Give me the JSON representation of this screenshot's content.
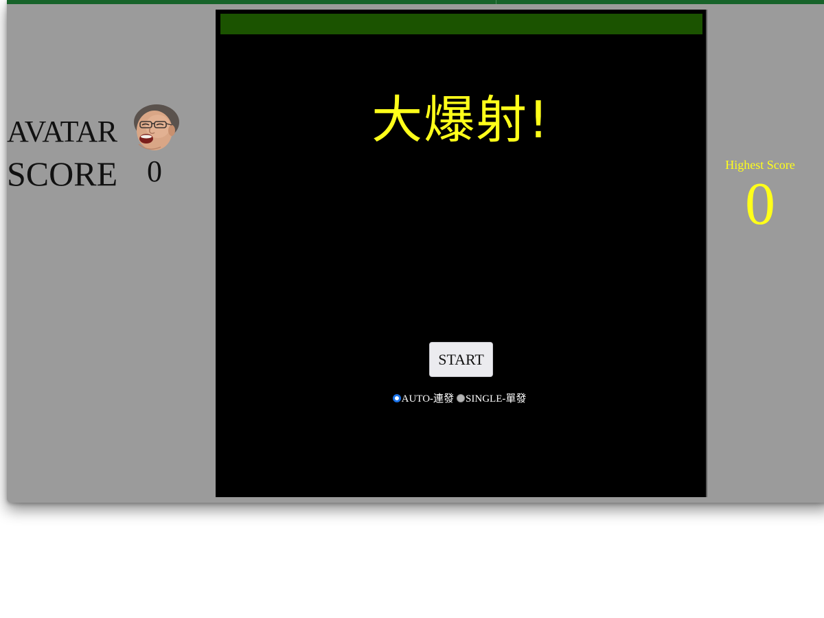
{
  "left_panel": {
    "avatar_label": "AVATAR",
    "score_label": "SCORE",
    "score_value": "0"
  },
  "game": {
    "title": "大爆射!",
    "start_label": "START",
    "modes": [
      {
        "label": "AUTO-連發",
        "selected": true
      },
      {
        "label": "SINGLE-單發",
        "selected": false
      }
    ]
  },
  "right_panel": {
    "highest_score_label": "Highest Score",
    "highest_score_value": "0"
  },
  "colors": {
    "page_background": "#9b9b9b",
    "game_background": "#000000",
    "game_bar": "#1b5300",
    "title_color": "#ffff1a",
    "highest_score_color": "#ffff1a",
    "radio_selected": "#1a72e8"
  },
  "icons": {
    "avatar": "face-avatar-icon"
  }
}
